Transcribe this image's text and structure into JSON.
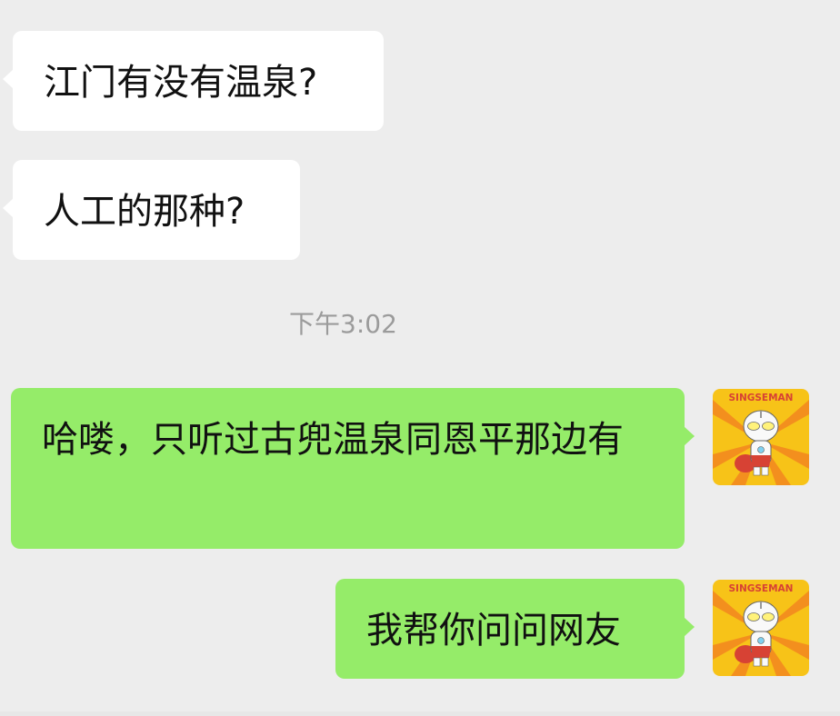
{
  "messages": [
    {
      "text": "江门有没有温泉?"
    },
    {
      "text": "人工的那种?"
    },
    {
      "text": "哈喽，只听过古兜温泉同恩平那边有"
    },
    {
      "text": "我帮你问问网友"
    }
  ],
  "timestamp": "下午3:02",
  "avatar": {
    "label": "SINGSEMAN",
    "colors": {
      "background": "#f7c318",
      "rays": "#f38f1e",
      "figure_body": "#f9f9f9",
      "figure_red": "#d74234"
    }
  },
  "colors": {
    "chat_background": "#ededed",
    "incoming_bubble": "#ffffff",
    "outgoing_bubble": "#95ec69",
    "timestamp_text": "#9b9b9b"
  }
}
